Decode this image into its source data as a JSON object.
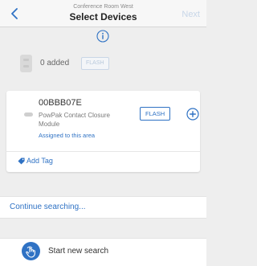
{
  "header": {
    "subtitle": "Conference Room West",
    "title": "Select Devices",
    "next_label": "Next"
  },
  "summary": {
    "added_text": "0 added",
    "flash_label": "FLASH"
  },
  "device": {
    "serial": "00BBB07E",
    "model": "PowPak Contact Closure Module",
    "status": "Assigned to this area",
    "flash_label": "FLASH",
    "add_tag_label": "Add Tag"
  },
  "actions": {
    "continue_label": "Continue searching...",
    "new_search_label": "Start new search"
  },
  "colors": {
    "accent": "#2f72c4",
    "disabled_accent": "#c7d6e8",
    "background": "#eeeeee"
  },
  "icons": [
    "back-chevron-icon",
    "info-icon",
    "device-icon",
    "add-circle-icon",
    "tag-icon",
    "touch-hand-icon"
  ]
}
